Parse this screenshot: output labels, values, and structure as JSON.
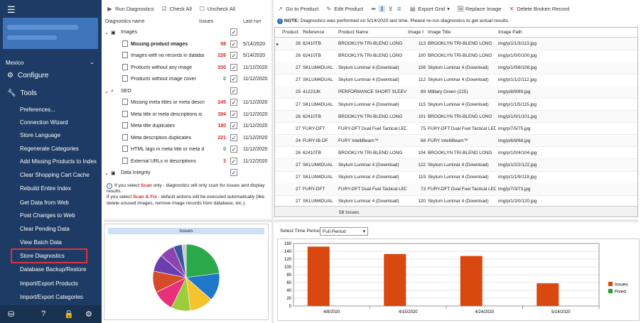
{
  "sidebar": {
    "store": "Mexico",
    "configure": "Configure",
    "tools": "Tools",
    "items": [
      "Preferences...",
      "Connection Wizard",
      "Store Language",
      "Regenerate Categories",
      "Add Missing Products to Index",
      "Clear Shopping Cart Cache",
      "Rebuild Entire Index",
      "Get Data from Web",
      "Post Changes to Web",
      "Clear Pending Data",
      "View Batch Data",
      "Store Diagnostics",
      "Database Backup/Restore",
      "Import/Export Products",
      "Import/Export Categories"
    ]
  },
  "left_toolbar": {
    "run": "Run Diagnostics",
    "check_all": "Check All",
    "uncheck_all": "Uncheck All"
  },
  "diagnostics": {
    "col_name": "Diagnostics name",
    "col_issues": "Issues",
    "col_last_run": "Last run",
    "groups": [
      {
        "name": "Images",
        "checked": true,
        "items": [
          {
            "name": "Missing product images",
            "count": "58",
            "date": "5/14/2020",
            "bold": true
          },
          {
            "name": "Images with no records in databa",
            "count": "226",
            "date": "5/14/2020"
          },
          {
            "name": "Products without any image",
            "count": "200",
            "date": "11/12/2020"
          },
          {
            "name": "Products without image cover",
            "count": "0",
            "date": "11/12/2020"
          }
        ]
      },
      {
        "name": "SEO",
        "checked": true,
        "items": [
          {
            "name": "Missing meta titles or meta descri",
            "count": "245",
            "date": "11/12/2020"
          },
          {
            "name": "Meta title or meta descriptions is",
            "count": "394",
            "date": "11/12/2020"
          },
          {
            "name": "Meta title duplicates",
            "count": "180",
            "date": "11/12/2020"
          },
          {
            "name": "Meta description duplicates",
            "count": "221",
            "date": "11/12/2020"
          },
          {
            "name": "HTML tags in meta title or meta d",
            "count": "0",
            "date": "11/12/2020"
          },
          {
            "name": "External URLs in descriptions",
            "count": "3",
            "date": "11/12/2020"
          }
        ]
      },
      {
        "name": "Data Integrity",
        "checked": true,
        "items": []
      }
    ]
  },
  "note_left": {
    "p1a": "If you select ",
    "scan": "Scan",
    "p1b": " only - diagnostics will only scan for issues and display results.",
    "p2a": "If you select ",
    "scanfix": "Scan & Fix",
    "p2b": " - default actions will be executed automatically (like delete unused images, remove image records from database, etc.)."
  },
  "right_toolbar": [
    "Go to Product",
    "Edit Product",
    "Export Grid",
    "Replace Image",
    "Delete Broken Record"
  ],
  "note_right": {
    "label": "NOTE:",
    "text": " Diagnostics was performed on 5/14/2020 last time. Please re-run diagnostics to get actual results."
  },
  "grid": {
    "columns": [
      "Product",
      "Reference",
      "Product Name",
      "Image I",
      "Image Title",
      "Image Path"
    ],
    "rows": [
      [
        "26",
        "62410TB",
        "BROOKLYN TRI-BLEND LONG",
        "113",
        "BROOKLYN TRI-BLEND LONG",
        "img/p/1/1/3/113.jpg"
      ],
      [
        "26",
        "62410TB",
        "BROOKLYN TRI-BLEND LONG",
        "100",
        "BROOKLYN TRI-BLEND LONG",
        "img/p/1/0/0/100.jpg"
      ],
      [
        "27",
        "SKLUM4DUAL",
        "Skylum Luminar 4 (Download)",
        "108",
        "Skylum Luminar 4 (Download)",
        "img/p/1/0/8/108.jpg"
      ],
      [
        "27",
        "SKLUM4DUAL",
        "Skylum Luminar 4 (Download)",
        "112",
        "Skylum Luminar 4 (Download)",
        "img/p/1/1/2/112.jpg"
      ],
      [
        "25",
        "41223JK",
        "PERFORMANCE SHORT SLEEVE",
        "89",
        "Military Green (225)",
        "img/p/8/9/89.jpg"
      ],
      [
        "27",
        "SKLUM4DUAL",
        "Skylum Luminar 4 (Download)",
        "115",
        "Skylum Luminar 4 (Download)",
        "img/p/1/1/5/115.jpg"
      ],
      [
        "26",
        "62410TB",
        "BROOKLYN TRI-BLEND LONG",
        "101",
        "BROOKLYN TRI-BLEND LONG",
        "img/p/1/0/1/101.jpg"
      ],
      [
        "27",
        "FURY-DFT",
        "FURY-DFT Dual Fuel Tactical LED",
        "75",
        "FURY-DFT Dual Fuel Tactical LED",
        "img/p/7/5/75.jpg"
      ],
      [
        "24",
        "FURY-IB-DF",
        "FURY IntelliBeam™",
        "68",
        "FURY IntelliBeam™",
        "img/p/6/8/68.jpg"
      ],
      [
        "26",
        "62410TB",
        "BROOKLYN TRI-BLEND LONG",
        "104",
        "BROOKLYN TRI-BLEND LONG",
        "img/p/1/0/4/104.jpg"
      ],
      [
        "27",
        "SKLUM4DUAL",
        "Skylum Luminar 4 (Download)",
        "122",
        "Skylum Luminar 4 (Download)",
        "img/p/1/2/2/122.jpg"
      ],
      [
        "27",
        "SKLUM4DUAL",
        "Skylum Luminar 4 (Download)",
        "119",
        "Skylum Luminar 4 (Download)",
        "img/p/1/1/9/119.jpg"
      ],
      [
        "27",
        "FURY-DFT",
        "FURY-DFT Dual Fuel Tactical LED",
        "73",
        "FURY-DFT Dual Fuel Tactical LED",
        "img/p/7/3/73.jpg"
      ],
      [
        "27",
        "SKLUM4DUAL",
        "Skylum Luminar 4 (Download)",
        "120",
        "Skylum Luminar 4 (Download)",
        "img/p/1/2/0/120.jpg"
      ]
    ],
    "footer": "58 Issues"
  },
  "time_period": {
    "label": "Select Time Period",
    "value": "Full Period"
  },
  "chart_data": [
    {
      "type": "pie",
      "title": "Issues",
      "values": [
        22,
        13,
        11,
        9,
        10,
        10,
        8,
        7,
        4,
        2
      ],
      "colors": [
        "#2aa84a",
        "#1f77c8",
        "#f6c22e",
        "#9ccd3a",
        "#e8317a",
        "#d44c2a",
        "#6b3fb0",
        "#8e44ad",
        "#3a56a0",
        "#c9c9c9"
      ]
    },
    {
      "type": "bar",
      "categories": [
        "4/8/2020",
        "4/15/2020",
        "4/24/2020",
        "5/14/2020"
      ],
      "series": [
        {
          "name": "Issues",
          "values": [
            152,
            133,
            128,
            58
          ],
          "color": "#d9480f"
        },
        {
          "name": "Fixed",
          "values": [
            0,
            0,
            0,
            0
          ],
          "color": "#2a9a2a"
        }
      ],
      "ylim": [
        0,
        160
      ],
      "yticks": [
        0,
        20,
        40,
        60,
        80,
        100,
        120,
        140,
        160
      ],
      "legend": "right"
    }
  ]
}
